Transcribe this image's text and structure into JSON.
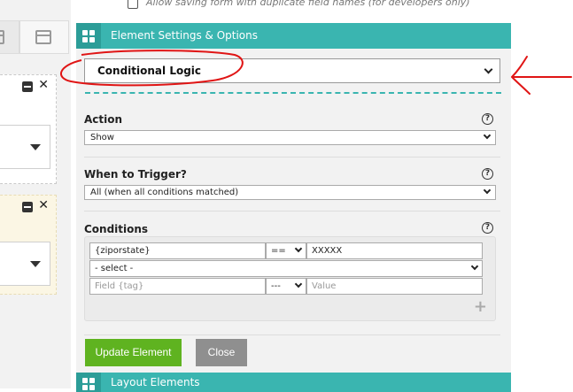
{
  "top_option": {
    "label": "Allow saving form with duplicate field names (for developers only)",
    "checked": false
  },
  "panel": {
    "header_title": "Element Settings & Options",
    "settings_dropdown": {
      "selected": "Conditional Logic"
    },
    "action": {
      "label": "Action",
      "selected": "Show"
    },
    "trigger": {
      "label": "When to Trigger?",
      "selected": "All (when all conditions matched)"
    },
    "conditions": {
      "label": "Conditions",
      "rows": [
        {
          "field": "{ziporstate}",
          "operator": "==",
          "value": "XXXXX"
        },
        {
          "select": "- select -"
        },
        {
          "field_placeholder": "Field {tag}",
          "operator": "---",
          "value_placeholder": "Value"
        }
      ],
      "add_symbol": "+"
    },
    "buttons": {
      "update": "Update Element",
      "close": "Close"
    },
    "footer_title": "Layout Elements"
  },
  "colors": {
    "teal": "#3ab5b0",
    "teal_dark": "#2c9d98",
    "update_green": "#5fb320",
    "close_gray": "#8f8f8f",
    "annotation_red": "#e01515"
  },
  "icons": [
    "grid-icon",
    "help-icon",
    "minus-icon",
    "close-x-icon",
    "caret-down-icon",
    "plus-icon"
  ]
}
